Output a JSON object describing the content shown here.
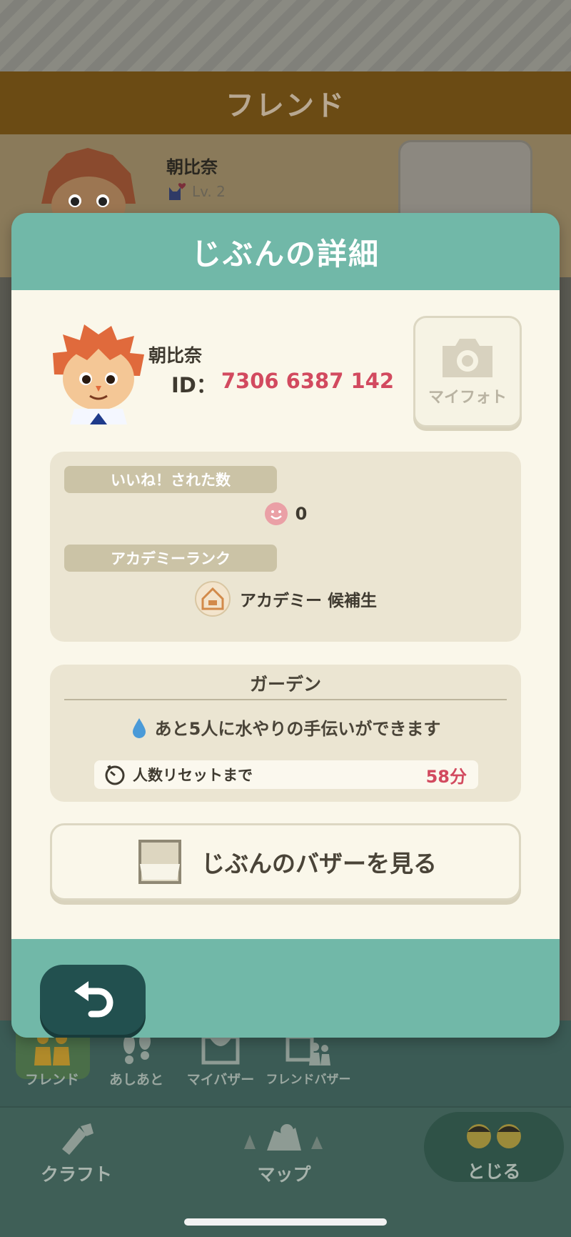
{
  "background": {
    "header_title": "フレンド",
    "friend": {
      "name": "朝比奈",
      "level": "Lv. 2"
    }
  },
  "modal": {
    "title": "じぶんの詳細",
    "profile": {
      "name": "朝比奈",
      "id_label": "ID：",
      "id_value": "7306 6387 142"
    },
    "my_photo_label": "マイフォト",
    "likes_label": "いいね！された数",
    "likes_count": "0",
    "academy_rank_label": "アカデミーランク",
    "academy_rank_value": "アカデミー 候補生",
    "garden": {
      "title": "ガーデン",
      "watering_text": "あと5人に水やりの手伝いができます",
      "reset_label": "人数リセットまで",
      "reset_value": "58分"
    },
    "bazaar_button": "じぶんのバザーを見る"
  },
  "nav": {
    "tabs": [
      "フレンド",
      "あしあと",
      "マイバザー",
      "フレンドバザー"
    ],
    "active_tab": "フレンド",
    "bottom": {
      "craft": "クラフト",
      "map": "マップ",
      "close": "とじる"
    }
  },
  "colors": {
    "accent_teal": "#71b8a8",
    "id_pink": "#d24a5f",
    "back_button": "#22504f"
  }
}
